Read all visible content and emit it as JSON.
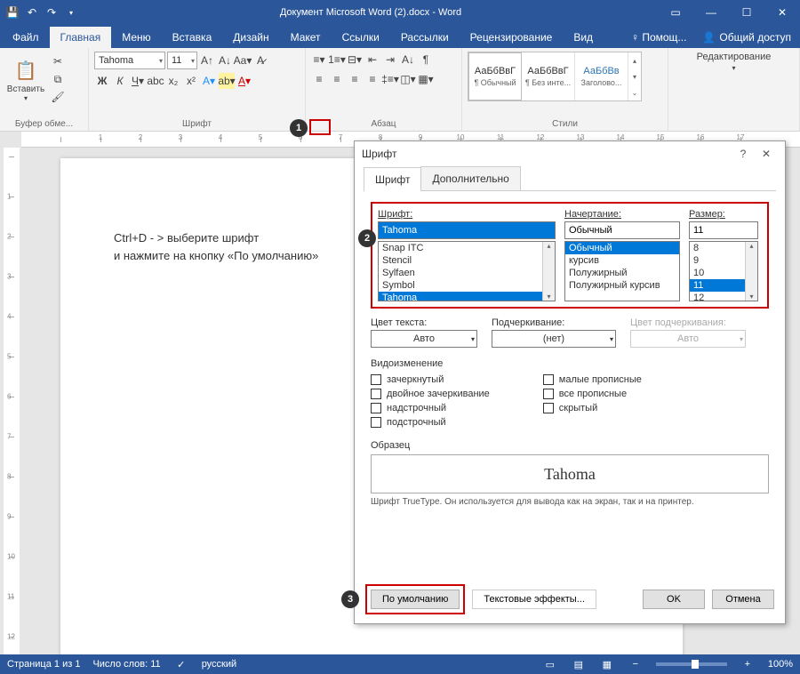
{
  "app": {
    "title": "Документ Microsoft Word (2).docx - Word"
  },
  "tabs": {
    "file": "Файл",
    "home": "Главная",
    "menu": "Меню",
    "insert": "Вставка",
    "design": "Дизайн",
    "layout": "Макет",
    "references": "Ссылки",
    "mailings": "Рассылки",
    "review": "Рецензирование",
    "view": "Вид",
    "help": "♀ Помощ...",
    "share": "Общий доступ"
  },
  "ribbon": {
    "clipboard": {
      "paste": "Вставить",
      "label": "Буфер обме..."
    },
    "font": {
      "name": "Tahoma",
      "size": "11",
      "label": "Шрифт"
    },
    "paragraph": {
      "label": "Абзац"
    },
    "styles": {
      "preview": "АаБбВвГ",
      "preview_heading": "АаБбВв",
      "s1": "¶ Обычный",
      "s2": "¶ Без инте...",
      "s3": "Заголово...",
      "label": "Стили"
    },
    "editing": {
      "label": "Редактирование"
    }
  },
  "document": {
    "line1": "Ctrl+D - > выберите шрифт",
    "line2": "и нажмите на кнопку «По умолчанию»"
  },
  "dialog": {
    "title": "Шрифт",
    "tab_font": "Шрифт",
    "tab_advanced": "Дополнительно",
    "font_label": "Шрифт:",
    "font_value": "Tahoma",
    "font_list": [
      "Snap ITC",
      "Stencil",
      "Sylfaen",
      "Symbol",
      "Tahoma"
    ],
    "style_label": "Начертание:",
    "style_value": "Обычный",
    "style_list": [
      "Обычный",
      "курсив",
      "Полужирный",
      "Полужирный курсив"
    ],
    "size_label": "Размер:",
    "size_value": "11",
    "size_list": [
      "8",
      "9",
      "10",
      "11",
      "12"
    ],
    "color_label": "Цвет текста:",
    "color_value": "Авто",
    "underline_label": "Подчеркивание:",
    "underline_value": "(нет)",
    "ucolor_label": "Цвет подчеркивания:",
    "ucolor_value": "Авто",
    "effects_title": "Видоизменение",
    "eff1": "зачеркнутый",
    "eff2": "двойное зачеркивание",
    "eff3": "надстрочный",
    "eff4": "подстрочный",
    "eff5": "малые прописные",
    "eff6": "все прописные",
    "eff7": "скрытый",
    "preview_title": "Образец",
    "preview_text": "Tahoma",
    "preview_desc": "Шрифт TrueType. Он используется для вывода как на экран, так и на принтер.",
    "btn_default": "По умолчанию",
    "btn_texteffects": "Текстовые эффекты...",
    "btn_ok": "OK",
    "btn_cancel": "Отмена"
  },
  "status": {
    "page": "Страница 1 из 1",
    "words": "Число слов: 11",
    "lang": "русский",
    "zoom": "100%"
  },
  "badges": {
    "b1": "1",
    "b2": "2",
    "b3": "3"
  }
}
